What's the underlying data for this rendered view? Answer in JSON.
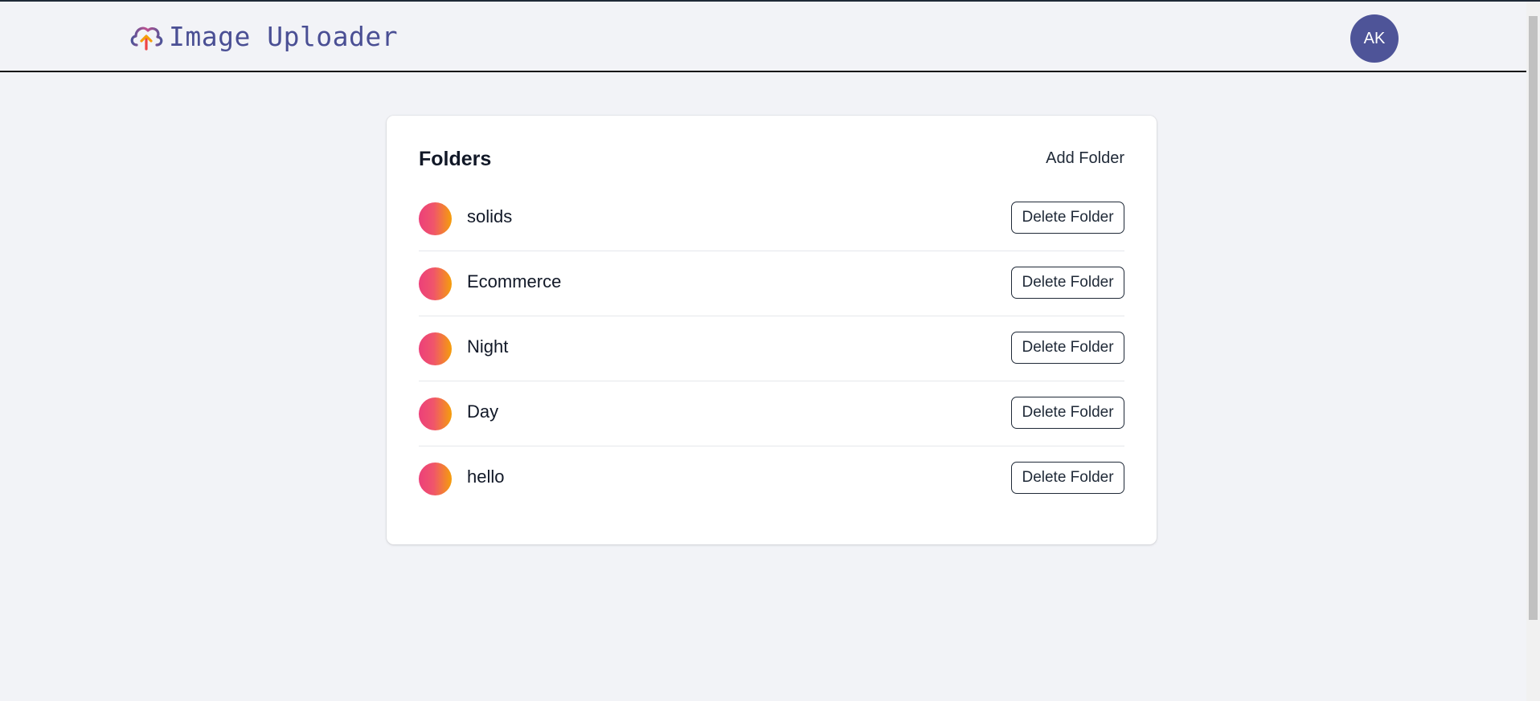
{
  "app": {
    "title": "Image Uploader",
    "logo_icon": "cloud-upload-icon",
    "user_initials": "AK",
    "colors": {
      "brand": "#4a4f94",
      "avatar": "#4e5498",
      "folder_gradient_start": "#ec407a",
      "folder_gradient_end": "#f59e0b",
      "background": "#f2f3f7"
    }
  },
  "folders_card": {
    "title": "Folders",
    "add_label": "Add Folder",
    "delete_label": "Delete Folder",
    "folders": [
      {
        "name": "solids"
      },
      {
        "name": "Ecommerce"
      },
      {
        "name": "Night"
      },
      {
        "name": "Day"
      },
      {
        "name": "hello"
      }
    ]
  }
}
